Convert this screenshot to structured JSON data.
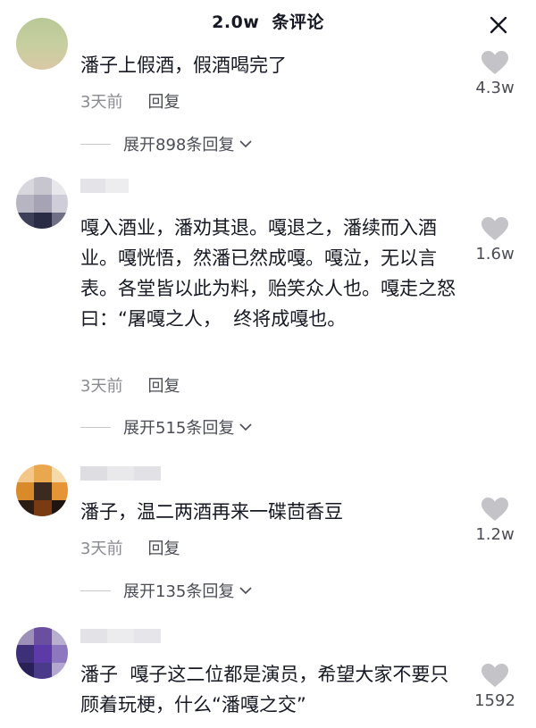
{
  "header": {
    "count": "2.0w",
    "title": "条评论"
  },
  "colors": {
    "text": "#161823",
    "secondary": "#8a8b91",
    "heart": "#c4c4c8"
  },
  "comments": [
    {
      "text": "潘子上假酒，假酒喝完了",
      "time": "3天前",
      "reply": "回复",
      "likes": "4.3w",
      "expand": "展开898条回复"
    },
    {
      "text": "嘎入酒业，潘劝其退。嘎退之，潘续而入酒业。嘎恍悟，然潘已然成嘎。嘎泣，无以言表。各堂皆以此为料，贻笑众人也。嘎走之怒曰：“屠嘎之人，  终将成嘎也。",
      "time": "3天前",
      "reply": "回复",
      "likes": "1.6w",
      "expand": "展开515条回复"
    },
    {
      "text": "潘子，温二两酒再来一碟茴香豆",
      "time": "3天前",
      "reply": "回复",
      "likes": "1.2w",
      "expand": "展开135条回复"
    },
    {
      "text": "潘子  嘎子这二位都是演员，希望大家不要只顾着玩梗，什么“潘嘎之交”",
      "likes": "1592"
    }
  ]
}
